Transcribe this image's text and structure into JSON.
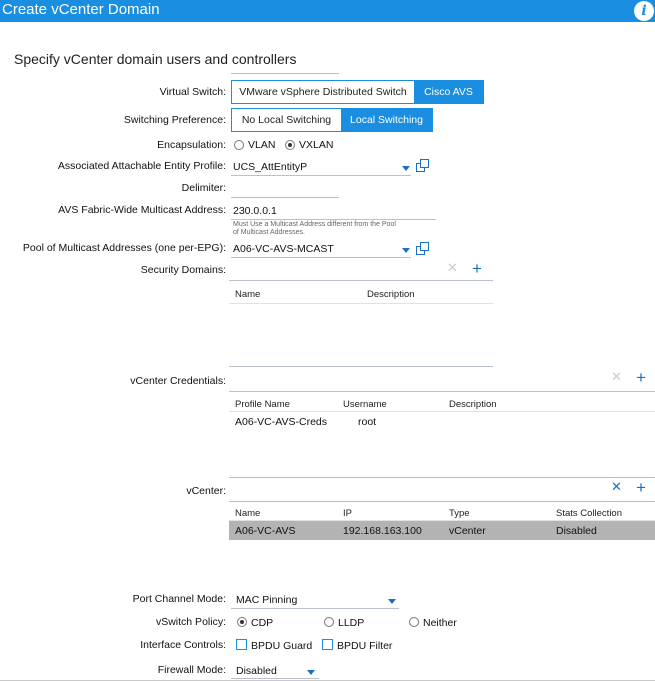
{
  "dialog": {
    "title": "Create vCenter Domain",
    "subtitle": "Specify vCenter domain users and controllers",
    "info_icon": "info-icon"
  },
  "virtual_switch": {
    "label": "Virtual Switch:",
    "options": [
      "VMware vSphere Distributed Switch",
      "Cisco AVS"
    ],
    "selected": "Cisco AVS"
  },
  "switching_preference": {
    "label": "Switching Preference:",
    "options": [
      "No Local Switching",
      "Local Switching"
    ],
    "selected": "Local Switching"
  },
  "encapsulation": {
    "label": "Encapsulation:",
    "options": [
      "VLAN",
      "VXLAN"
    ],
    "selected": "VXLAN"
  },
  "aaep": {
    "label": "Associated Attachable Entity Profile:",
    "value": "UCS_AttEntityP"
  },
  "delimiter": {
    "label": "Delimiter:",
    "value": ""
  },
  "multicast_address": {
    "label": "AVS Fabric-Wide Multicast Address:",
    "value": "230.0.0.1",
    "hint_line1": "Must Use a Multicast Address different from the Pool",
    "hint_line2": "of Multicast Addresses."
  },
  "multicast_pool": {
    "label": "Pool of Multicast Addresses (one per-EPG):",
    "value": "A06-VC-AVS-MCAST"
  },
  "security_domains": {
    "label": "Security Domains:",
    "columns": [
      "Name",
      "Description"
    ],
    "rows": []
  },
  "vcenter_credentials": {
    "label": "vCenter Credentials:",
    "columns": [
      "Profile Name",
      "Username",
      "Description"
    ],
    "rows": [
      {
        "profile_name": "A06-VC-AVS-Creds",
        "username": "root",
        "description": ""
      }
    ]
  },
  "vcenter": {
    "label": "vCenter:",
    "columns": [
      "Name",
      "IP",
      "Type",
      "Stats Collection"
    ],
    "rows": [
      {
        "name": "A06-VC-AVS",
        "ip": "192.168.163.100",
        "type": "vCenter",
        "stats": "Disabled"
      }
    ]
  },
  "port_channel_mode": {
    "label": "Port Channel Mode:",
    "value": "MAC Pinning"
  },
  "vswitch_policy": {
    "label": "vSwitch Policy:",
    "options": [
      "CDP",
      "LLDP",
      "Neither"
    ],
    "selected": "CDP"
  },
  "interface_controls": {
    "label": "Interface Controls:",
    "options": [
      "BPDU Guard",
      "BPDU Filter"
    ],
    "checked": []
  },
  "firewall_mode": {
    "label": "Firewall Mode:",
    "value": "Disabled"
  },
  "colors": {
    "accent": "#1a8ee0",
    "link_icon": "#1a6fc4",
    "selected_row": "#b3b3b3"
  }
}
